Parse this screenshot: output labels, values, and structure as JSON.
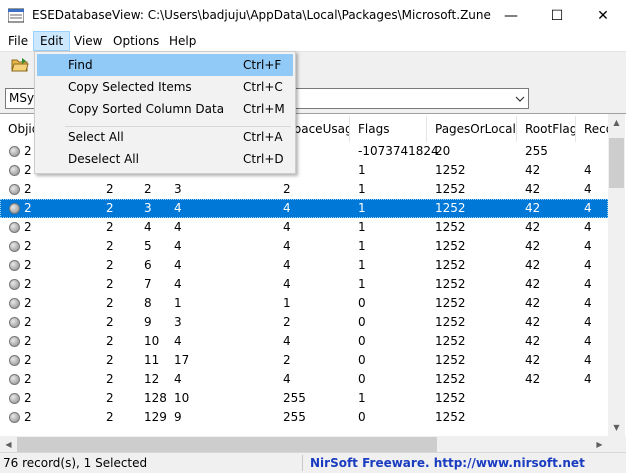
{
  "window": {
    "title": "ESEDatabaseView:  C:\\Users\\badjuju\\AppData\\Local\\Packages\\Microsoft.ZuneMusi...",
    "minimize": "—",
    "maximize": "☐",
    "close": "✕"
  },
  "menubar": {
    "items": [
      "File",
      "Edit",
      "View",
      "Options",
      "Help"
    ]
  },
  "table_selector": {
    "value": "MSys"
  },
  "edit_menu": {
    "items": [
      {
        "label": "Find",
        "shortcut": "Ctrl+F"
      },
      {
        "label": "Copy Selected Items",
        "shortcut": "Ctrl+C"
      },
      {
        "label": "Copy Sorted Column Data",
        "shortcut": "Ctrl+M"
      },
      {
        "label": "Select All",
        "shortcut": "Ctrl+A"
      },
      {
        "label": "Deselect All",
        "shortcut": "Ctrl+D"
      }
    ]
  },
  "list": {
    "columns": [
      "Objid",
      "",
      "",
      "",
      "SpaceUsage",
      "Flags",
      "PagesOrLocale",
      "RootFlag",
      "Reco"
    ],
    "rows": [
      [
        "2",
        "",
        "",
        "",
        "",
        "-1073741824",
        "20",
        "255",
        ""
      ],
      [
        "2",
        "",
        "",
        "",
        "",
        "1",
        "1252",
        "42",
        "4"
      ],
      [
        "2",
        "2",
        "2",
        "3",
        "2",
        "1",
        "1252",
        "42",
        "4"
      ],
      [
        "2",
        "2",
        "3",
        "4",
        "4",
        "1",
        "1252",
        "42",
        "4"
      ],
      [
        "2",
        "2",
        "4",
        "4",
        "4",
        "1",
        "1252",
        "42",
        "4"
      ],
      [
        "2",
        "2",
        "5",
        "4",
        "4",
        "1",
        "1252",
        "42",
        "4"
      ],
      [
        "2",
        "2",
        "6",
        "4",
        "4",
        "1",
        "1252",
        "42",
        "4"
      ],
      [
        "2",
        "2",
        "7",
        "4",
        "4",
        "1",
        "1252",
        "42",
        "4"
      ],
      [
        "2",
        "2",
        "8",
        "1",
        "1",
        "0",
        "1252",
        "42",
        "4"
      ],
      [
        "2",
        "2",
        "9",
        "3",
        "2",
        "0",
        "1252",
        "42",
        "4"
      ],
      [
        "2",
        "2",
        "10",
        "4",
        "4",
        "0",
        "1252",
        "42",
        "4"
      ],
      [
        "2",
        "2",
        "11",
        "17",
        "2",
        "0",
        "1252",
        "42",
        "4"
      ],
      [
        "2",
        "2",
        "12",
        "4",
        "4",
        "0",
        "1252",
        "42",
        "4"
      ],
      [
        "2",
        "2",
        "128",
        "10",
        "255",
        "1",
        "1252",
        "",
        ""
      ],
      [
        "2",
        "2",
        "129",
        "9",
        "255",
        "0",
        "1252",
        "",
        ""
      ]
    ]
  },
  "status": {
    "records": "76 record(s), 1 Selected",
    "credit": "NirSoft Freeware.  http://www.nirsoft.net"
  },
  "colors": {
    "selection": "#0078d7",
    "menu_highlight": "#91c9f7",
    "credit_text": "#1a3cc0"
  }
}
